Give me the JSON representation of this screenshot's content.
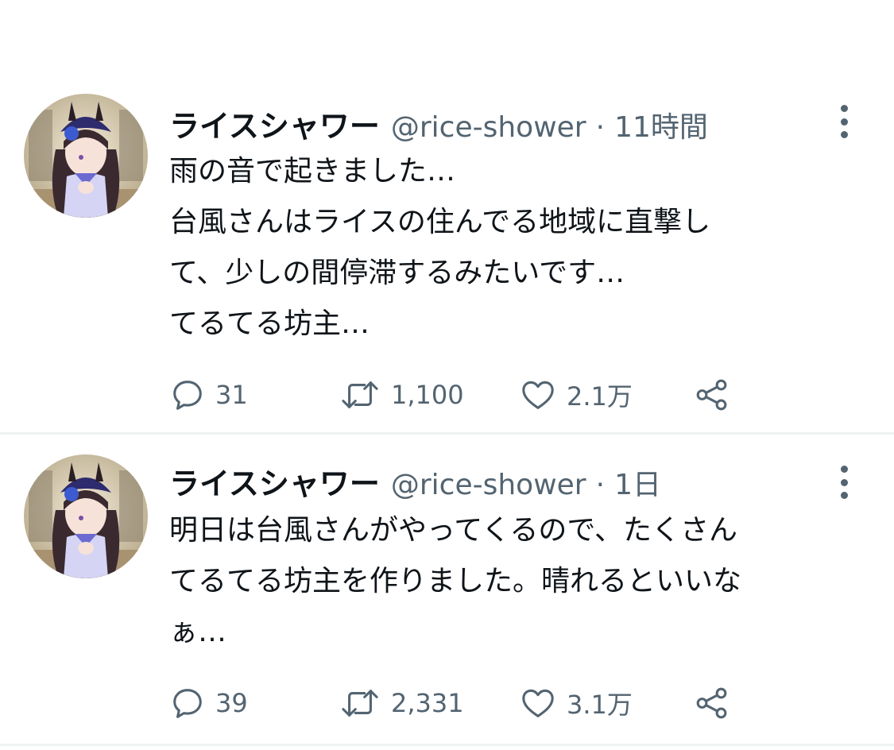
{
  "tweets": [
    {
      "name": "ライスシャワー",
      "handle": "@rice-shower",
      "separator": "·",
      "time": "11時間",
      "lines": [
        "雨の音で起きました…",
        "台風さんはライスの住んでる地域に直撃し",
        "て、少しの間停滞するみたいです…",
        "てるてる坊主…"
      ],
      "replies": "31",
      "retweets": "1,100",
      "likes": "2.1万"
    },
    {
      "name": "ライスシャワー",
      "handle": "@rice-shower",
      "separator": "·",
      "time": "1日",
      "lines": [
        "明日は台風さんがやってくるので、たくさん",
        "てるてる坊主を作りました。晴れるといいな",
        "ぁ…"
      ],
      "replies": "39",
      "retweets": "2,331",
      "likes": "3.1万"
    }
  ],
  "icons": {
    "reply": "reply-icon",
    "retweet": "retweet-icon",
    "like": "heart-icon",
    "share": "share-icon",
    "more": "more-icon"
  },
  "colors": {
    "text": "#0f1419",
    "secondary": "#536471",
    "divider": "#eff3f4"
  }
}
